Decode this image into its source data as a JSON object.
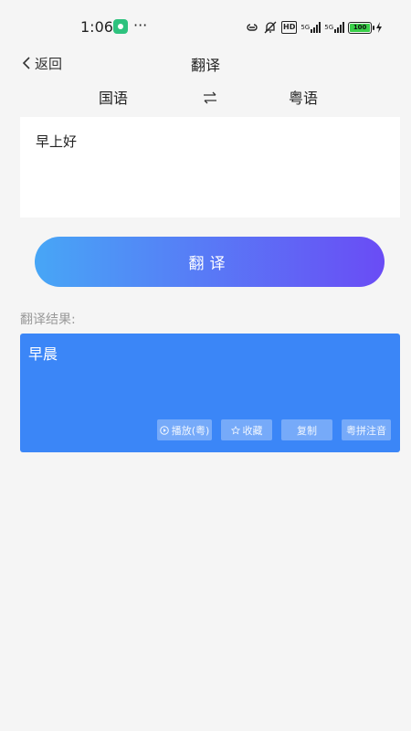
{
  "status_bar": {
    "time": "1:06",
    "more": "···",
    "battery": "100",
    "net_label_1": "5G",
    "net_label_2": "5G",
    "hd_label": "HD"
  },
  "nav": {
    "back_label": "返回",
    "title": "翻译"
  },
  "languages": {
    "source": "国语",
    "target": "粤语"
  },
  "input": {
    "value": "早上好"
  },
  "translate_button": {
    "label": "翻译"
  },
  "result": {
    "label": "翻译结果:",
    "text": "早晨",
    "actions": {
      "play": "播放(粤)",
      "favorite": "收藏",
      "copy": "复制",
      "pinyin": "粤拼注音"
    }
  },
  "colors": {
    "background": "#f5f5f5",
    "gradient_start": "#47a6f6",
    "gradient_end": "#6a4cf5",
    "result_bg": "#3b86f7"
  }
}
